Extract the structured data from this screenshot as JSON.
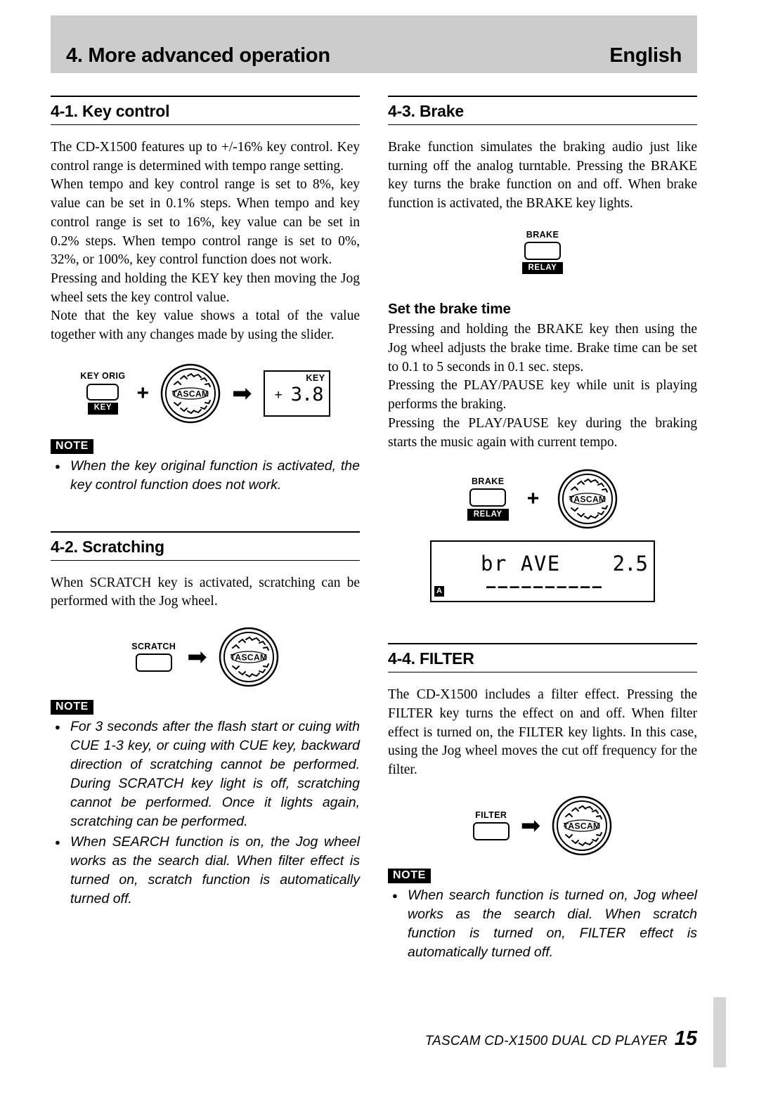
{
  "header": {
    "title": "4. More advanced operation",
    "language": "English"
  },
  "sections": {
    "key_control": {
      "title": "4-1. Key control",
      "paragraphs": [
        "The CD-X1500 features up to +/-16% key control. Key control range is determined with tempo range setting.",
        "When tempo and key control range is set to 8%, key value can be set in 0.1% steps.  When tempo and key control range is set to 16%, key value can be set in 0.2% steps.  When tempo control range is set to 0%, 32%, or 100%, key control function does not work.",
        "Pressing and holding the KEY key then moving the Jog wheel sets the key control value.",
        "Note that the key value shows a total of the value together with any changes made by using the slider."
      ],
      "figure": {
        "key_label": "KEY ORIG",
        "key_sub_label": "KEY",
        "plus": "+",
        "arrow": "➡",
        "jog_brand": "TASCAM",
        "display": {
          "tag": "KEY",
          "sign": "+",
          "value": "3.8"
        }
      },
      "note": {
        "tag": "NOTE",
        "items": [
          "When the key original function is activated, the key control function does not work."
        ]
      }
    },
    "scratching": {
      "title": "4-2. Scratching",
      "paragraphs": [
        "When SCRATCH key is activated, scratching can be performed with the Jog wheel."
      ],
      "figure": {
        "key_label": "SCRATCH",
        "arrow": "➡",
        "jog_brand": "TASCAM"
      },
      "note": {
        "tag": "NOTE",
        "items": [
          "For 3 seconds after the flash start or cuing with CUE 1-3 key, or cuing with CUE key, backward direction of scratching cannot be performed. During SCRATCH key light is off, scratching cannot be performed. Once it lights again, scratching can be performed.",
          "When SEARCH function is on, the Jog wheel works as the search dial.  When filter effect is turned on, scratch function is automatically turned off."
        ]
      }
    },
    "brake": {
      "title": "4-3. Brake",
      "paragraphs": [
        "Brake function simulates the braking audio just like turning off the analog turntable.  Pressing the BRAKE key turns the brake function on and off.  When brake function is activated, the BRAKE key lights."
      ],
      "figure": {
        "key_label": "BRAKE",
        "key_sub_label": "RELAY"
      },
      "subsection": {
        "title": "Set the brake time",
        "paragraphs": [
          "Pressing and holding the BRAKE key then using the Jog wheel adjusts the brake time.  Brake time can be set to 0.1 to 5 seconds in 0.1 sec. steps.",
          "Pressing the PLAY/PAUSE key while unit is playing performs the braking.",
          "Pressing the PLAY/PAUSE key during the braking starts the music again with current tempo."
        ],
        "figure": {
          "key_label": "BRAKE",
          "key_sub_label": "RELAY",
          "plus": "+",
          "jog_brand": "TASCAM",
          "display": {
            "word": "br AVE",
            "number": "2.5",
            "indicator": "A",
            "dashes": "——————————"
          }
        }
      }
    },
    "filter": {
      "title": "4-4. FILTER",
      "paragraphs": [
        "The CD-X1500 includes a filter effect.  Pressing the FILTER key turns the effect on and off.  When filter effect is turned on, the FILTER key lights.  In this case, using the Jog wheel moves the cut off frequency for the filter."
      ],
      "figure": {
        "key_label": "FILTER",
        "arrow": "➡",
        "jog_brand": "TASCAM"
      },
      "note": {
        "tag": "NOTE",
        "items": [
          "When search function is turned on, Jog wheel works as the search dial.  When scratch function is turned on, FILTER effect is automatically turned off."
        ]
      }
    }
  },
  "footer": {
    "text": "TASCAM  CD-X1500  DUAL CD PLAYER",
    "page": "15"
  }
}
